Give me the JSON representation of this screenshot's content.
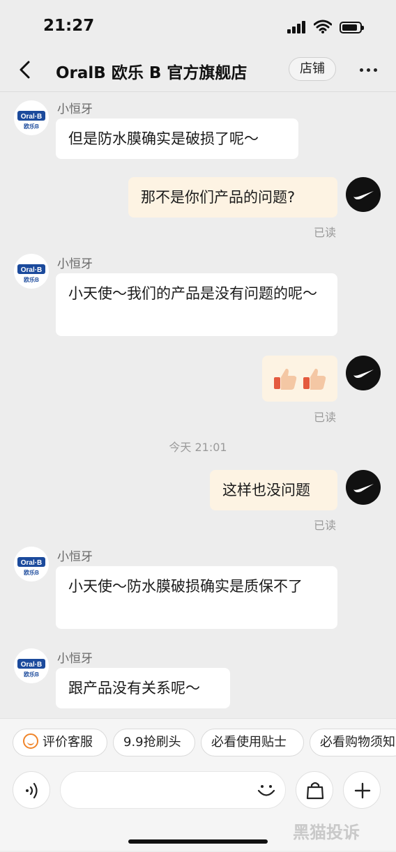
{
  "status_bar": {
    "time": "21:27"
  },
  "header": {
    "title": "OralB 欧乐 B 官方旗舰店",
    "store_button": "店铺"
  },
  "brand_logo": {
    "line1": "Oral·B",
    "line2": "欧乐B"
  },
  "messages": [
    {
      "sender": "小恒牙",
      "text": "但是防水膜确实是破损了呢～"
    },
    {
      "text": "那不是你们产品的问题?",
      "status": "已读"
    },
    {
      "sender": "小恒牙",
      "text": "小天使～我们的产品是没有问题的呢～"
    },
    {
      "text": "👍🏼👍🏼",
      "status": "已读"
    },
    {
      "timestamp": "今天 21:01"
    },
    {
      "text": "这样也没问题",
      "status": "已读"
    },
    {
      "sender": "小恒牙",
      "text": "小天使～防水膜破损确实是质保不了"
    },
    {
      "sender": "小恒牙",
      "text": "跟产品没有关系呢～"
    }
  ],
  "quick_replies": [
    "评价客服",
    "9.9抢刷头",
    "必看使用贴士",
    "必看购物须知"
  ],
  "watermark": "黑猫投诉",
  "colors": {
    "incoming_bubble": "#ffffff",
    "outgoing_bubble": "#fdf3e3",
    "background": "#ededed",
    "accent": "#f0852a"
  },
  "icons": [
    "back-chevron",
    "more-dots",
    "voice",
    "emoji",
    "shopping-bag",
    "plus"
  ]
}
